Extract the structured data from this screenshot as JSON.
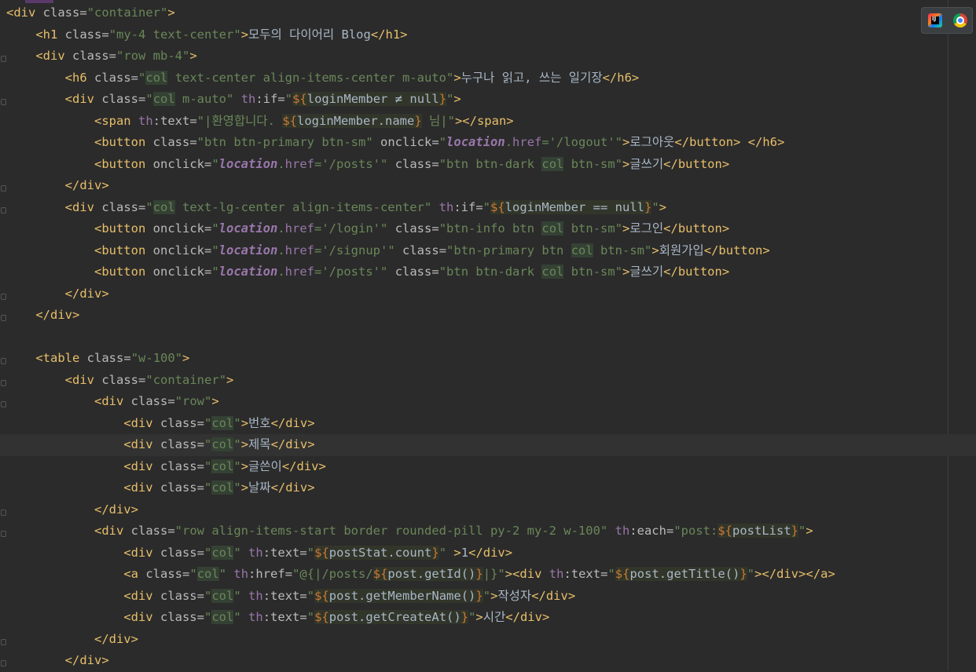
{
  "editor": {
    "lines": [
      "<div class=\"container\">",
      "    <h1 class=\"my-4 text-center\">모두의 다이어리 Blog</h1>",
      "    <div class=\"row mb-4\">",
      "        <h6 class=\"col text-center align-items-center m-auto\">누구나 읽고, 쓰는 일기장</h6>",
      "        <div class=\"col m-auto\" th:if=\"${loginMember ≠ null}\">",
      "            <span th:text=\"|환영합니다. ${loginMember.name} 님|\"></span>",
      "            <button class=\"btn btn-primary btn-sm\" onclick=\"location.href='/logout'\">로그아웃</button> </h6>",
      "            <button onclick=\"location.href='/posts'\" class=\"btn btn-dark col btn-sm\">글쓰기</button>",
      "        </div>",
      "        <div class=\"col text-lg-center align-items-center\" th:if=\"${loginMember == null}\">",
      "            <button onclick=\"location.href='/login'\" class=\"btn-info btn col btn-sm\">로그인</button>",
      "            <button onclick=\"location.href='/signup'\" class=\"btn-primary btn col btn-sm\">회원가입</button>",
      "            <button onclick=\"location.href='/posts'\" class=\"btn btn-dark col btn-sm\">글쓰기</button>",
      "        </div>",
      "    </div>",
      "",
      "    <table class=\"w-100\">",
      "        <div class=\"container\">",
      "            <div class=\"row\">",
      "                <div class=\"col\">번호</div>",
      "                <div class=\"col\">제목</div>",
      "                <div class=\"col\">글쓴이</div>",
      "                <div class=\"col\">날짜</div>",
      "            </div>",
      "            <div class=\"row align-items-start border rounded-pill py-2 my-2 w-100\" th:each=\"post:${postList}\">",
      "                <div class=\"col\" th:text=\"${postStat.count}\" >1</div>",
      "                <a class=\"col\" th:href=\"@{|/posts/${post.getId()}|}\"><div th:text=\"${post.getTitle()}\"></div></a>",
      "                <div class=\"col\" th:text=\"${post.getMemberName()}\">작성자</div>",
      "                <div class=\"col\" th:text=\"${post.getCreateAt()}\">시간</div>",
      "            </div>",
      "        </div>"
    ]
  },
  "toolbar": {
    "icons": [
      "jetbrains-ide-icon",
      "chrome-icon"
    ],
    "ide_badge": "IJ"
  },
  "colors": {
    "background": "#2b2b2b",
    "tag": "#e8bf6a",
    "string": "#6a8759",
    "keyword": "#cc7832",
    "namespace": "#9876aa",
    "text": "#a9b7c6"
  }
}
